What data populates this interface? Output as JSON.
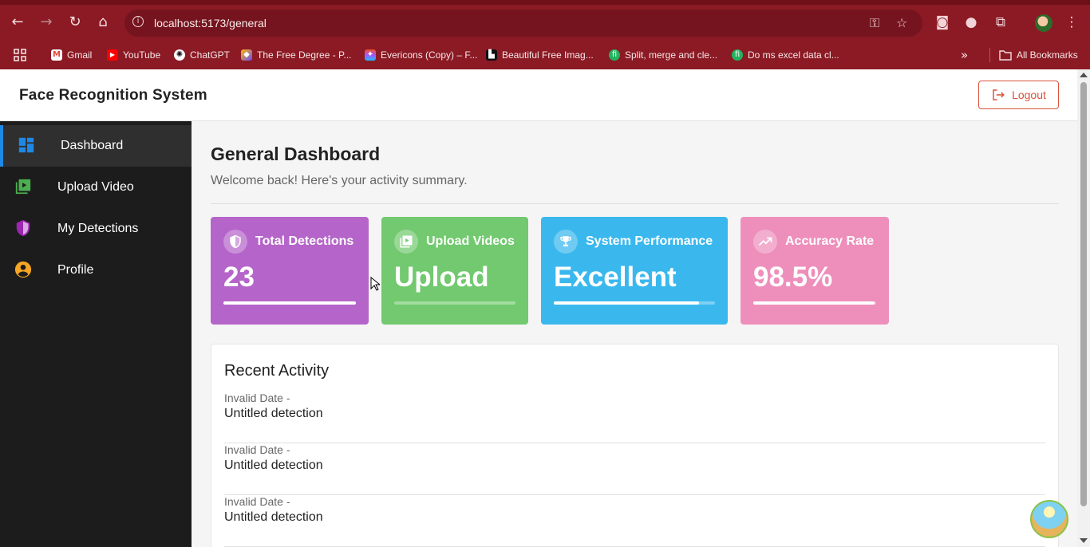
{
  "browser": {
    "url": "localhost:5173/general",
    "bookmarks": [
      {
        "label": "Gmail",
        "color": "#ea4335"
      },
      {
        "label": "YouTube",
        "color": "#ff0000"
      },
      {
        "label": "ChatGPT",
        "color": "#1f1f1f"
      },
      {
        "label": "The Free Degree - P...",
        "color": "#6a4cff"
      },
      {
        "label": "Evericons (Copy) – F...",
        "color": "#a259ff"
      },
      {
        "label": "Beautiful Free Imag...",
        "color": "#111111"
      },
      {
        "label": "Split, merge and cle...",
        "color": "#22b35e"
      },
      {
        "label": "Do ms excel data cl...",
        "color": "#22b35e"
      }
    ],
    "all_bookmarks": "All Bookmarks"
  },
  "header": {
    "title": "Face Recognition System",
    "logout": "Logout"
  },
  "sidebar": {
    "items": [
      {
        "label": "Dashboard",
        "icon": "dashboard-icon",
        "active": true
      },
      {
        "label": "Upload Video",
        "icon": "video-library-icon"
      },
      {
        "label": "My Detections",
        "icon": "shield-icon"
      },
      {
        "label": "Profile",
        "icon": "account-circle-icon"
      }
    ]
  },
  "main": {
    "title": "General Dashboard",
    "subtitle": "Welcome back! Here's your activity summary.",
    "cards": [
      {
        "label": "Total Detections",
        "value": "23",
        "icon": "shield-icon",
        "color": "#b565c9",
        "progress": 1.0
      },
      {
        "label": "Upload Videos",
        "value": "Upload",
        "icon": "video-library-icon",
        "color": "#72c96f",
        "progress": 0.0
      },
      {
        "label": "System Performance",
        "value": "Excellent",
        "icon": "trophy-icon",
        "color": "#3ab8ee",
        "progress": 0.9
      },
      {
        "label": "Accuracy Rate",
        "value": "98.5%",
        "icon": "trending-up-icon",
        "color": "#ee8fbb",
        "progress": 0.985
      }
    ],
    "recent": {
      "title": "Recent Activity",
      "items": [
        {
          "date": "Invalid Date -",
          "name": "Untitled detection"
        },
        {
          "date": "Invalid Date -",
          "name": "Untitled detection"
        },
        {
          "date": "Invalid Date -",
          "name": "Untitled detection"
        }
      ]
    }
  }
}
